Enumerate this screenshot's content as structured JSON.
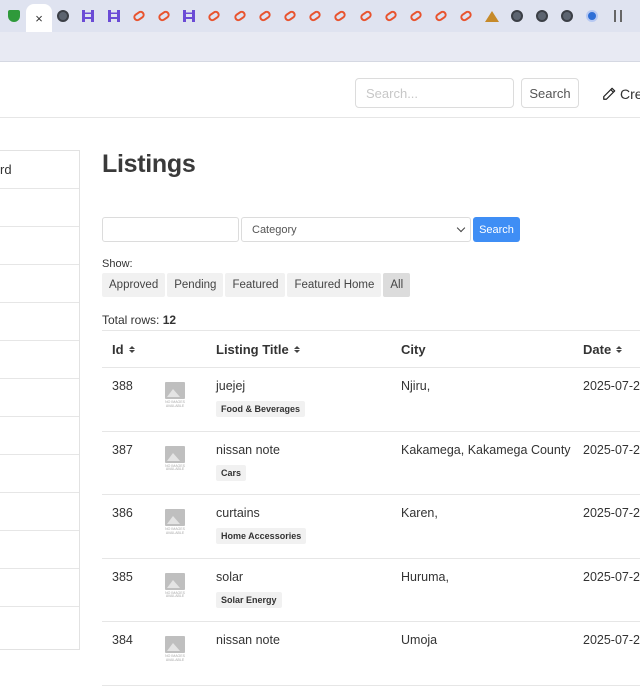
{
  "browser": {
    "tabs": [
      {
        "icon": "shield-icon"
      },
      {
        "icon": "close-icon",
        "active": true
      },
      {
        "icon": "globe-icon"
      },
      {
        "icon": "ladder-icon"
      },
      {
        "icon": "ladder-icon"
      },
      {
        "icon": "link-icon"
      },
      {
        "icon": "link-icon"
      },
      {
        "icon": "ladder-icon"
      },
      {
        "icon": "link-icon"
      },
      {
        "icon": "link-icon"
      },
      {
        "icon": "link-icon"
      },
      {
        "icon": "link-icon"
      },
      {
        "icon": "link-icon"
      },
      {
        "icon": "link-icon"
      },
      {
        "icon": "link-icon"
      },
      {
        "icon": "link-icon"
      },
      {
        "icon": "link-icon"
      },
      {
        "icon": "link-icon"
      },
      {
        "icon": "link-icon"
      },
      {
        "icon": "mountain-icon"
      },
      {
        "icon": "globe-icon"
      },
      {
        "icon": "globe-icon"
      },
      {
        "icon": "globe-icon"
      },
      {
        "icon": "circle-c-icon"
      },
      {
        "icon": "tuning-fork-icon"
      }
    ],
    "close_glyph": "×"
  },
  "header": {
    "search_placeholder": "Search...",
    "search_button": "Search",
    "create_label": "Cre"
  },
  "sidebar": {
    "items": [
      {
        "label": "rd"
      },
      {
        "label": ""
      },
      {
        "label": ""
      },
      {
        "label": ""
      },
      {
        "label": ""
      },
      {
        "label": ""
      },
      {
        "label": ""
      },
      {
        "label": ""
      },
      {
        "label": ""
      },
      {
        "label": ""
      },
      {
        "label": ""
      },
      {
        "label": ""
      }
    ]
  },
  "main": {
    "title": "Listings",
    "filter": {
      "keyword_value": "",
      "category_selected": "Category",
      "button": "Search"
    },
    "show": {
      "label": "Show:",
      "options": [
        "Approved",
        "Pending",
        "Featured",
        "Featured Home",
        "All"
      ],
      "active": "All"
    },
    "total_rows_label": "Total rows:",
    "total_rows_value": "12",
    "table": {
      "headers": {
        "id": "Id",
        "title": "Listing Title",
        "city": "City",
        "date": "Date"
      },
      "no_image_caption": "NO IMAGES AVAILABLE",
      "rows": [
        {
          "id": "388",
          "title": "juejej",
          "category": "Food & Beverages",
          "city": "Njiru,",
          "date": "2025-07-2"
        },
        {
          "id": "387",
          "title": "nissan note",
          "category": "Cars",
          "city": "Kakamega, Kakamega County",
          "date": "2025-07-2"
        },
        {
          "id": "386",
          "title": "curtains",
          "category": "Home Accessories",
          "city": "Karen,",
          "date": "2025-07-2"
        },
        {
          "id": "385",
          "title": "solar",
          "category": "Solar Energy",
          "city": "Huruma,",
          "date": "2025-07-2"
        },
        {
          "id": "384",
          "title": "nissan note",
          "category": "",
          "city": "Umoja",
          "date": "2025-07-2"
        }
      ]
    }
  }
}
